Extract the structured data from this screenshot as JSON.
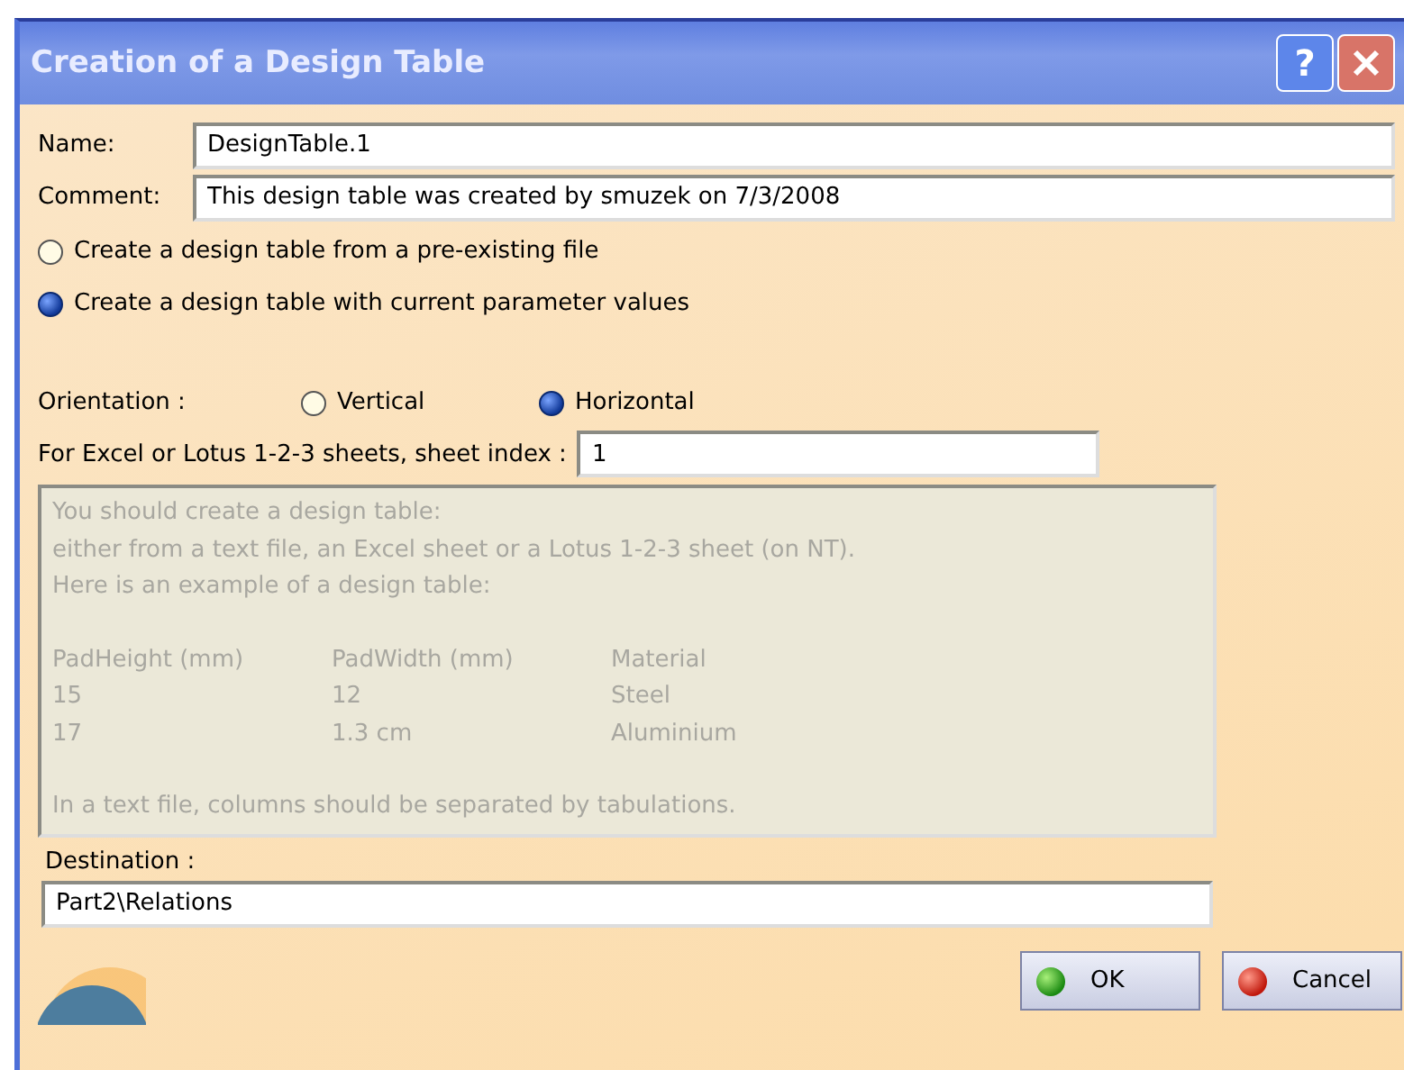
{
  "window": {
    "title": "Creation of a Design Table",
    "help_button": "?"
  },
  "name": {
    "label": "Name:",
    "value": "DesignTable.1"
  },
  "comment": {
    "label": "Comment:",
    "value": "This design table was created by smuzek on 7/3/2008"
  },
  "source_options": [
    {
      "label": "Create a design table from a pre-existing file",
      "selected": false
    },
    {
      "label": "Create a design table with current parameter values",
      "selected": true
    }
  ],
  "orientation": {
    "label": "Orientation :",
    "options": [
      {
        "label": "Vertical",
        "selected": false
      },
      {
        "label": "Horizontal",
        "selected": true
      }
    ]
  },
  "sheet_index": {
    "label": "For Excel or Lotus 1-2-3 sheets, sheet index :",
    "value": "1"
  },
  "info_box": {
    "lines": [
      "You should create a design table:",
      "either from a text file, an Excel sheet or a Lotus 1-2-3 sheet (on NT).",
      "Here is an example of a design table:"
    ],
    "example_rows": [
      [
        "PadHeight (mm)",
        "PadWidth (mm)",
        "Material"
      ],
      [
        "15",
        "12",
        "Steel"
      ],
      [
        "17",
        "1.3 cm",
        "Aluminium"
      ]
    ],
    "footer": "In a text file, columns should be separated by tabulations."
  },
  "destination": {
    "label": "Destination :",
    "value": "Part2\\Relations"
  },
  "buttons": [
    {
      "label": "OK",
      "kind": "ok"
    },
    {
      "label": "Cancel",
      "kind": "cancel"
    }
  ]
}
